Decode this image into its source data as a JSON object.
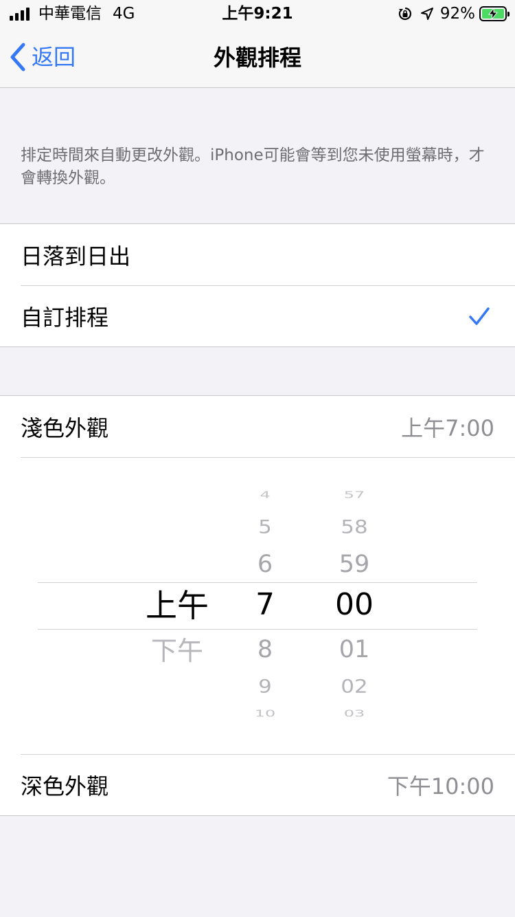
{
  "status_bar": {
    "carrier": "中華電信",
    "network": "4G",
    "time": "上午9:21",
    "battery_percent": "92%",
    "icons": [
      "signal-bars-icon",
      "rotation-lock-icon",
      "location-arrow-icon",
      "battery-charging-icon"
    ]
  },
  "nav": {
    "back_label": "返回",
    "title": "外觀排程"
  },
  "description": "排定時間來自動更改外觀。iPhone可能會等到您未使用螢幕時，才會轉換外觀。",
  "schedule_options": [
    {
      "label": "日落到日出",
      "selected": false
    },
    {
      "label": "自訂排程",
      "selected": true
    }
  ],
  "light": {
    "label": "淺色外觀",
    "value": "上午7:00"
  },
  "dark": {
    "label": "深色外觀",
    "value": "下午10:00"
  },
  "picker": {
    "period": {
      "selected": "上午",
      "after": [
        "下午"
      ]
    },
    "hour": {
      "before": [
        "4",
        "5",
        "6"
      ],
      "selected": "7",
      "after": [
        "8",
        "9",
        "10"
      ]
    },
    "minute": {
      "before": [
        "57",
        "58",
        "59"
      ],
      "selected": "00",
      "after": [
        "01",
        "02",
        "03"
      ]
    }
  },
  "colors": {
    "accent": "#3478f6",
    "background": "#f2f2f7",
    "secondary_text": "#8e8e93",
    "battery_fill": "#4cd964"
  }
}
